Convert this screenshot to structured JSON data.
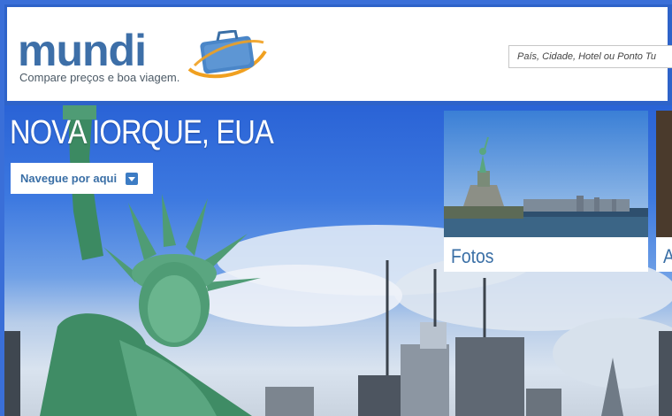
{
  "header": {
    "logo_text": "mundi",
    "tagline": "Compare preços e boa viagem.",
    "search_placeholder": "País, Cidade, Hotel ou Ponto Tu"
  },
  "hero": {
    "city_title": "NOVA IORQUE, EUA",
    "nav_button_label": "Navegue por aqui"
  },
  "cards": [
    {
      "label": "Fotos"
    },
    {
      "label": "A"
    }
  ],
  "colors": {
    "frame_blue": "#3a6fd8",
    "brand_blue": "#3d6fa8",
    "link_blue": "#3a6fa6",
    "suitcase_blue": "#4a86c8",
    "swoosh_orange": "#f0a020"
  }
}
